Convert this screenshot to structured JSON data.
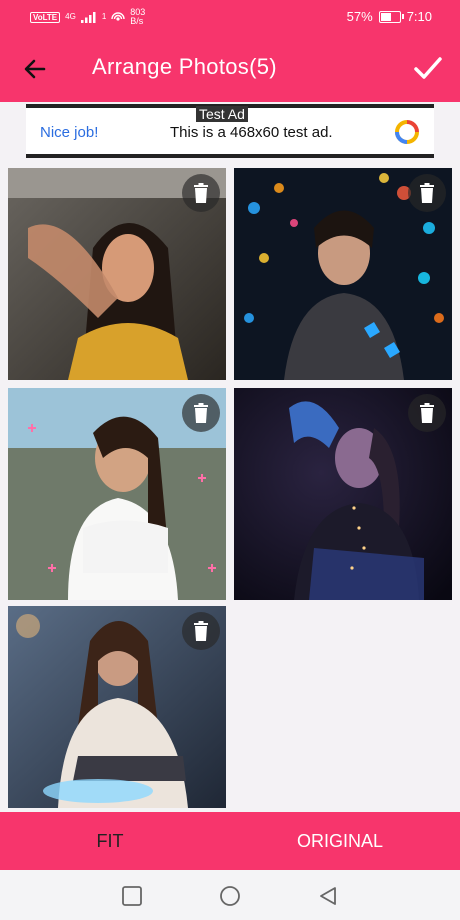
{
  "status_bar": {
    "carrier_badge": "VoLTE",
    "network": "4G",
    "sim": "1",
    "speed_value": "803",
    "speed_unit": "B/s",
    "battery_percent": "57%",
    "battery_level": 0.57,
    "time": "7:10"
  },
  "toolbar": {
    "title": "Arrange Photos(5)",
    "back_icon": "arrow-left-icon",
    "confirm_icon": "checkmark-icon"
  },
  "ad": {
    "badge": "Test Ad",
    "nice": "Nice job!",
    "text": "This is a 468x60 test ad."
  },
  "photos": [
    {
      "description_icon": "photo"
    },
    {
      "description_icon": "photo"
    },
    {
      "description_icon": "photo"
    },
    {
      "description_icon": "photo"
    },
    {
      "description_icon": "photo"
    }
  ],
  "bottom_bar": {
    "fit": "FIT",
    "original": "ORIGINAL"
  },
  "colors": {
    "accent": "#f7356c",
    "background": "#f4f2f5"
  }
}
